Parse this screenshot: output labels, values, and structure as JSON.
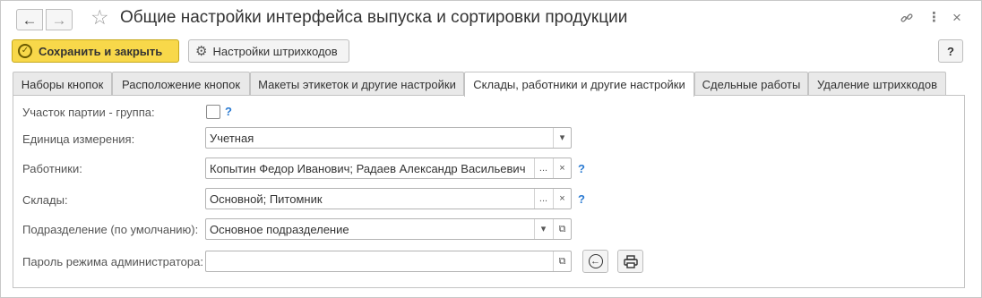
{
  "window": {
    "title": "Общие настройки интерфейса выпуска и сортировки продукции",
    "back_icon": "←",
    "forward_icon": "→",
    "star_icon": "☆",
    "link_icon": "🔗",
    "more_icon": "⋮",
    "close_icon": "×"
  },
  "toolbar": {
    "save_close_label": "Сохранить и закрыть",
    "save_close_icon": "✓",
    "barcode_settings_label": "Настройки штрихкодов",
    "barcode_settings_icon": "⚙",
    "help_label": "?"
  },
  "tabs": [
    {
      "label": "Наборы кнопок",
      "active": false
    },
    {
      "label": "Расположение кнопок",
      "active": false
    },
    {
      "label": "Макеты этикеток и другие настройки",
      "active": false
    },
    {
      "label": "Склады, работники и другие настройки",
      "active": true
    },
    {
      "label": "Сдельные работы",
      "active": false
    },
    {
      "label": "Удаление штрихкодов",
      "active": false
    }
  ],
  "form": {
    "batch_section_group": {
      "label": "Участок партии - группа:",
      "checked": false,
      "help": "?"
    },
    "unit": {
      "label": "Единица измерения:",
      "value": "Учетная",
      "dropdown_icon": "▾"
    },
    "workers": {
      "label": "Работники:",
      "value": "Копытин Федор Иванович; Радаев Александр Васильевич",
      "select_icon": "...",
      "clear_icon": "×",
      "help": "?"
    },
    "warehouses": {
      "label": "Склады:",
      "value": "Основной; Питомник",
      "select_icon": "...",
      "clear_icon": "×",
      "help": "?"
    },
    "department": {
      "label": "Подразделение (по умолчанию):",
      "value": "Основное подразделение",
      "dropdown_icon": "▾",
      "open_icon": "⧉"
    },
    "admin_password": {
      "label": "Пароль режима администратора:",
      "value": "",
      "open_icon": "⧉",
      "back_icon": "←",
      "print_icon": "printer-icon"
    }
  },
  "colors": {
    "accent": "#f8d84a",
    "help": "#2a7ad2",
    "tab_bg": "#e9e9e9"
  }
}
